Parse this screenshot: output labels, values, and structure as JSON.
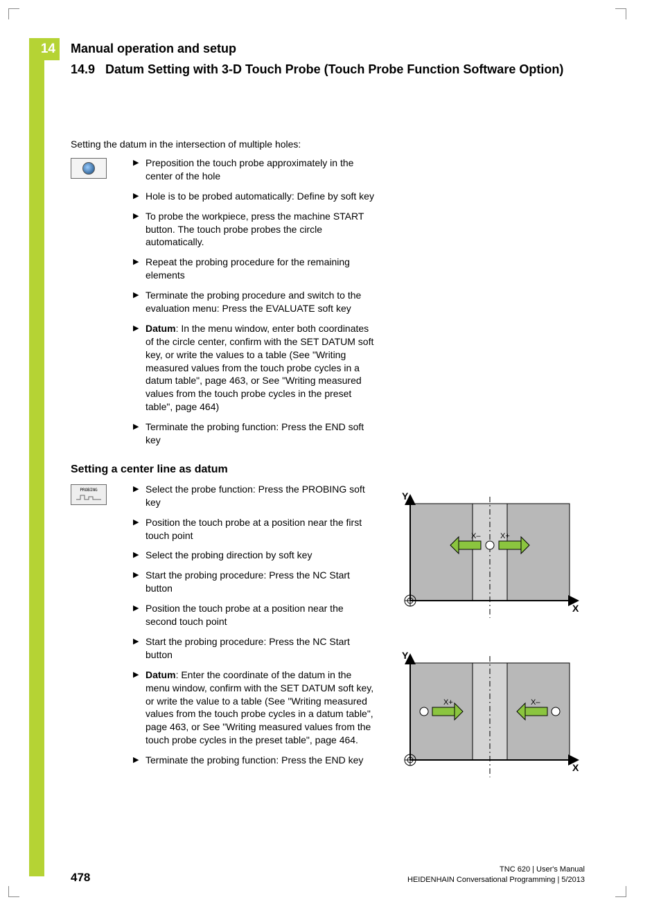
{
  "chapter_number": "14",
  "chapter_title": "Manual operation and setup",
  "section_number": "14.9",
  "section_title": "Datum Setting with 3-D Touch Probe (Touch Probe Function Software Option)",
  "intro1": "Setting the datum in the intersection of multiple holes:",
  "softkey2_label": "PROBING",
  "steps1": [
    {
      "bold": "",
      "text": "Preposition the touch probe approximately in the center of the hole"
    },
    {
      "bold": "",
      "text": "Hole is to be probed automatically: Define by soft key"
    },
    {
      "bold": "",
      "text": "To probe the workpiece, press the machine START button. The touch probe probes the circle automatically."
    },
    {
      "bold": "",
      "text": "Repeat the probing procedure for the remaining elements"
    },
    {
      "bold": "",
      "text": "Terminate the probing procedure and switch to the evaluation menu: Press the EVALUATE soft key"
    },
    {
      "bold": "Datum",
      "text": ": In the menu window, enter both coordinates of the circle center, confirm with the SET DATUM soft key, or write the values to a table (See \"Writing measured values from the touch probe cycles in a datum table\", page 463, or See \"Writing measured values from the touch probe cycles in the preset table\", page 464)"
    },
    {
      "bold": "",
      "text": "Terminate the probing function: Press the END soft key"
    }
  ],
  "subheading2": "Setting a center line as datum",
  "steps2": [
    {
      "bold": "",
      "text": "Select the probe function: Press the PROBING soft key"
    },
    {
      "bold": "",
      "text": "Position the touch probe at a position near the first touch point"
    },
    {
      "bold": "",
      "text": "Select the probing direction by soft key"
    },
    {
      "bold": "",
      "text": "Start the probing procedure: Press the NC Start button"
    },
    {
      "bold": "",
      "text": "Position the touch probe at a position near the second touch point"
    },
    {
      "bold": "",
      "text": "Start the probing procedure: Press the NC Start button"
    },
    {
      "bold": "Datum",
      "text": ": Enter the coordinate of the datum in the menu window, confirm with the SET DATUM soft key, or write the value to a table (See \"Writing measured values from the touch probe cycles in a datum table\", page 463, or See \"Writing measured values from the touch probe cycles in the preset table\", page 464."
    },
    {
      "bold": "",
      "text": "Terminate the probing function: Press the END key"
    }
  ],
  "diagram_labels": {
    "Y": "Y",
    "X": "X",
    "Xm": "X–",
    "Xp": "X+"
  },
  "page_number": "478",
  "footer_line1": "TNC 620 | User's Manual",
  "footer_line2": "HEIDENHAIN Conversational Programming | 5/2013"
}
